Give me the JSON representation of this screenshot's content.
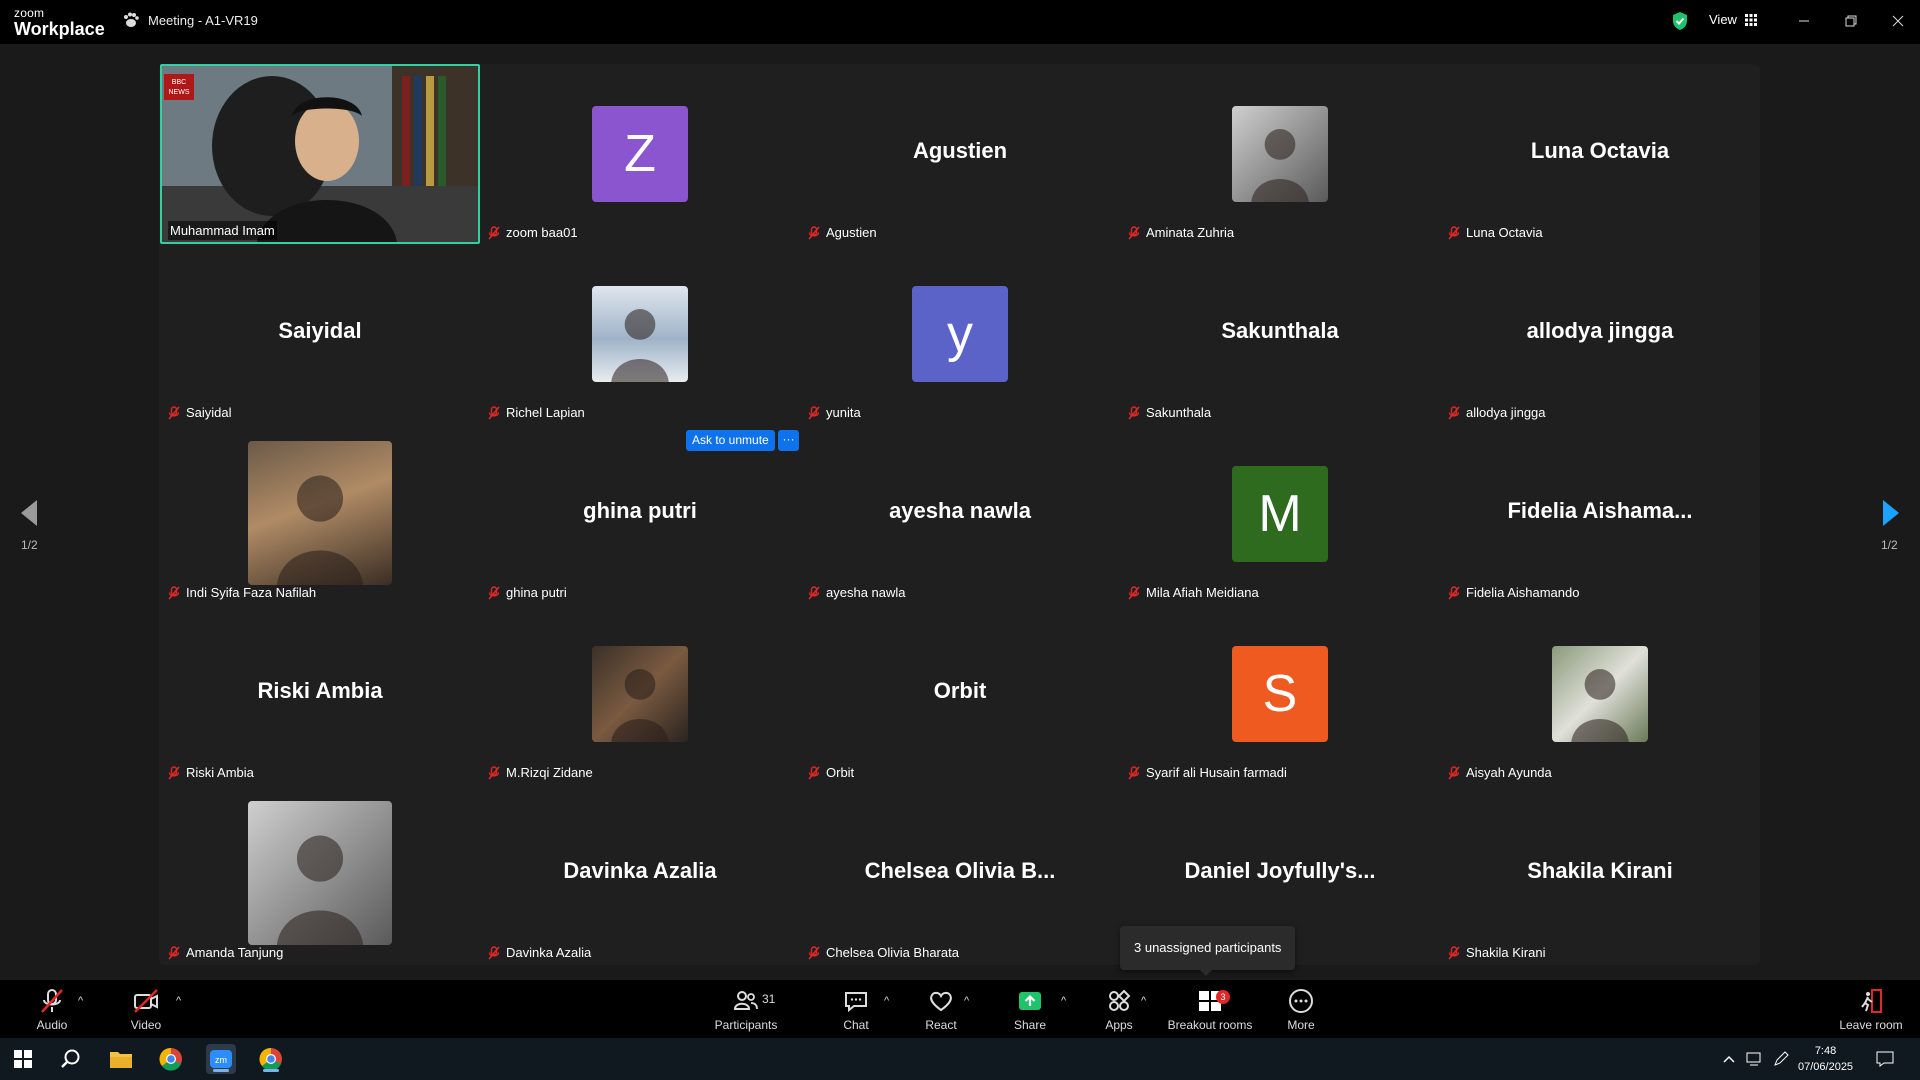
{
  "app": {
    "logo_line1": "zoom",
    "logo_line2": "Workplace",
    "meeting_title": "Meeting - A1-VR19",
    "view_label": "View"
  },
  "gallery": {
    "page_left": "1/2",
    "page_right": "1/2",
    "ask_unmute": "Ask to unmute",
    "ask_more": "···",
    "tooltip": "3 unassigned participants",
    "tiles": [
      {
        "label": "Muhammad Imam",
        "kind": "video",
        "big": ""
      },
      {
        "label": "zoom baa01",
        "kind": "letter",
        "big": "Z",
        "color": "#8a55cf"
      },
      {
        "label": "Agustien",
        "kind": "name",
        "big": "Agustien"
      },
      {
        "label": "Aminata Zuhria",
        "kind": "photo",
        "big": ""
      },
      {
        "label": "Luna Octavia",
        "kind": "name",
        "big": "Luna Octavia"
      },
      {
        "label": "Saiyidal",
        "kind": "name",
        "big": "Saiyidal"
      },
      {
        "label": "Richel Lapian",
        "kind": "photo",
        "big": ""
      },
      {
        "label": "yunita",
        "kind": "letter",
        "big": "y",
        "color": "#5b63c8"
      },
      {
        "label": "Sakunthala",
        "kind": "name",
        "big": "Sakunthala"
      },
      {
        "label": "allodya jingga",
        "kind": "name",
        "big": "allodya jingga"
      },
      {
        "label": "Indi Syifa Faza Nafilah",
        "kind": "photo-large",
        "big": ""
      },
      {
        "label": "ghina putri",
        "kind": "name",
        "big": "ghina putri"
      },
      {
        "label": "ayesha nawla",
        "kind": "name",
        "big": "ayesha nawla"
      },
      {
        "label": "Mila Afiah Meidiana",
        "kind": "letter",
        "big": "M",
        "color": "#2e6b1f"
      },
      {
        "label": "Fidelia Aishamando",
        "kind": "name",
        "big": "Fidelia  Aishama..."
      },
      {
        "label": "Riski Ambia",
        "kind": "name",
        "big": "Riski Ambia"
      },
      {
        "label": "M.Rizqi Zidane",
        "kind": "photo",
        "big": ""
      },
      {
        "label": "Orbit",
        "kind": "name",
        "big": "Orbit"
      },
      {
        "label": "Syarif ali Husain farmadi",
        "kind": "letter",
        "big": "S",
        "color": "#ee5a1f"
      },
      {
        "label": "Aisyah Ayunda",
        "kind": "photo",
        "big": ""
      },
      {
        "label": "Amanda Tanjung",
        "kind": "photo-large",
        "big": ""
      },
      {
        "label": "Davinka Azalia",
        "kind": "name",
        "big": "Davinka Azalia"
      },
      {
        "label": "Chelsea Olivia Bharata",
        "kind": "name",
        "big": "Chelsea Olivia B..."
      },
      {
        "label": "",
        "kind": "name",
        "big": "Daniel  Joyfully's..."
      },
      {
        "label": "Shakila Kirani",
        "kind": "name",
        "big": "Shakila Kirani"
      }
    ]
  },
  "toolbar": {
    "audio": "Audio",
    "video": "Video",
    "participants": "Participants",
    "participants_count": "31",
    "chat": "Chat",
    "react": "React",
    "share": "Share",
    "apps": "Apps",
    "breakout": "Breakout rooms",
    "breakout_badge": "3",
    "more": "More",
    "leave": "Leave room"
  },
  "taskbar": {
    "time": "7:48",
    "date": "07/06/2025"
  },
  "colors": {
    "active_border": "#2ed2a0",
    "share_green": "#1ec36b",
    "accent_blue": "#0e72ed",
    "mute_red": "#e02828"
  }
}
